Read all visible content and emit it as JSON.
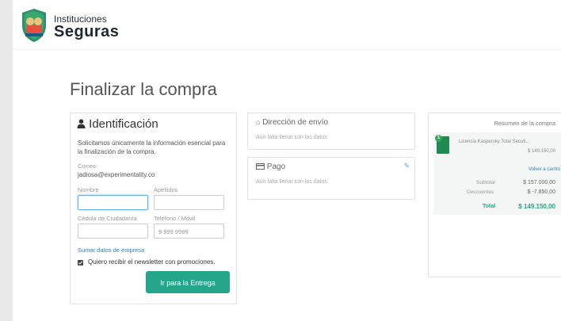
{
  "header": {
    "brand_line1": "Instituciones",
    "brand_line2": "Seguras"
  },
  "page_title": "Finalizar la compra",
  "identificacion": {
    "heading": "Identificación",
    "intro": "Solicitamos únicamente la información esencial para la finalización de la compra.",
    "email_label": "Correo:",
    "email_value": "jadiosa@experimentality.co",
    "nombre_label": "Nombre",
    "apellidos_label": "Apellidos",
    "cedula_label": "Cédula de Ciudadanía",
    "telefono_label": "Teléfono / Móvil",
    "telefono_placeholder": "9 999 9999",
    "empresa_link": "Sumar datos de empresa",
    "newsletter_label": "Quiero recibir el newsletter con promociones.",
    "newsletter_checked": true,
    "submit_label": "Ir para la Entrega"
  },
  "envio": {
    "heading": "Dirección de envío",
    "status": "Aún falta llenar con los datos"
  },
  "pago": {
    "heading": "Pago",
    "status": "Aún falta llenar con los datos"
  },
  "resumen": {
    "heading": "Resumen de la compra",
    "item_qty": "1",
    "item_name": "Licencia Kaspersky Total Secuti...",
    "item_price": "$ 149.150,00",
    "back_link": "Volver a carrito",
    "subtotal_label": "Subtotal",
    "subtotal_value": "$ 157.000,00",
    "descuentos_label": "Descuentos",
    "descuentos_value": "$ -7.850,00",
    "total_label": "Total",
    "total_value": "$ 149.150,00"
  },
  "colors": {
    "accent": "#25a58a",
    "link": "#2e7fc5",
    "focus": "#66afe9"
  }
}
